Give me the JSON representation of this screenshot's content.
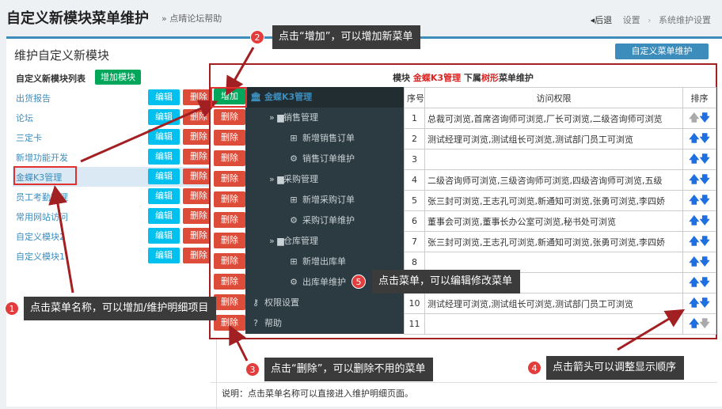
{
  "header": {
    "title": "自定义新模块菜单维护",
    "help": "» 点晴论坛帮助",
    "back": "后退",
    "crumbs": [
      "设置",
      "系统维护设置"
    ]
  },
  "panel": {
    "title": "维护自定义新模块",
    "top_button": "自定义菜单维护"
  },
  "module_list": {
    "heading": "自定义新模块列表",
    "add_button": "增加模块",
    "edit_label": "编辑",
    "delete_label": "删除",
    "items": [
      {
        "name": "出货报告"
      },
      {
        "name": "论坛"
      },
      {
        "name": "三定卡"
      },
      {
        "name": "新增功能开发"
      },
      {
        "name": "金蝶K3管理"
      },
      {
        "name": "员工考勤管理"
      },
      {
        "name": "常用网站访问"
      },
      {
        "name": "自定义模块2"
      },
      {
        "name": "自定义模块1"
      }
    ]
  },
  "frame": {
    "title_prefix": "模块 ",
    "title_module": "金蝶K3管理",
    "title_mid": " 下属",
    "title_tree": "树形",
    "title_suffix": "菜单维护",
    "add_label": "增加",
    "delete_label": "删除"
  },
  "tree": [
    {
      "label": "金蝶K3管理",
      "icon": "bank-icon",
      "glyph": "🏛",
      "indent": 0,
      "root": true
    },
    {
      "label": "销售管理",
      "icon": "folder-icon",
      "glyph": "» ▆",
      "indent": 1
    },
    {
      "label": "新增销售订单",
      "icon": "plus-square-icon",
      "glyph": "⊞",
      "indent": 2
    },
    {
      "label": "销售订单维护",
      "icon": "gear-icon",
      "glyph": "⚙",
      "indent": 2
    },
    {
      "label": "采购管理",
      "icon": "folder-icon",
      "glyph": "» ▆",
      "indent": 1
    },
    {
      "label": "新增采购订单",
      "icon": "plus-square-icon",
      "glyph": "⊞",
      "indent": 2
    },
    {
      "label": "采购订单维护",
      "icon": "gear-icon",
      "glyph": "⚙",
      "indent": 2
    },
    {
      "label": "仓库管理",
      "icon": "folder-icon",
      "glyph": "» ▆",
      "indent": 1
    },
    {
      "label": "新增出库单",
      "icon": "plus-square-icon",
      "glyph": "⊞",
      "indent": 2
    },
    {
      "label": "出库单维护",
      "icon": "gear-icon",
      "glyph": "⚙",
      "indent": 2
    },
    {
      "label": "权限设置",
      "icon": "key-icon",
      "glyph": "⚷",
      "indent": 0
    },
    {
      "label": "帮助",
      "icon": "help-icon",
      "glyph": "?",
      "indent": 0
    }
  ],
  "table": {
    "headers": [
      "序号",
      "访问权限",
      "排序"
    ],
    "rows": [
      {
        "no": "1",
        "perm": "总裁可浏览,首席咨询师可浏览,厂长可浏览,二级咨询师可浏览"
      },
      {
        "no": "2",
        "perm": "测试经理可浏览,测试组长可浏览,测试部门员工可浏览"
      },
      {
        "no": "3",
        "perm": ""
      },
      {
        "no": "4",
        "perm": "二级咨询师可浏览,三级咨询师可浏览,四级咨询师可浏览,五级"
      },
      {
        "no": "5",
        "perm": "张三封可浏览,王志孔可浏览,新通知可浏览,张勇可浏览,李四娇"
      },
      {
        "no": "6",
        "perm": "董事会可浏览,董事长办公室可浏览,秘书处可浏览"
      },
      {
        "no": "7",
        "perm": "张三封可浏览,王志孔可浏览,新通知可浏览,张勇可浏览,李四娇"
      },
      {
        "no": "8",
        "perm": ""
      },
      {
        "no": "9",
        "perm": ""
      },
      {
        "no": "10",
        "perm": "测试经理可浏览,测试组长可浏览,测试部门员工可浏览"
      },
      {
        "no": "11",
        "perm": ""
      }
    ]
  },
  "note": "说明：点击菜单名称可以直接进入维护明细页面。",
  "callouts": [
    {
      "num": "1",
      "text": "点击菜单名称，可以增加/维护明细项目"
    },
    {
      "num": "2",
      "text": "点击“增加”，可以增加新菜单"
    },
    {
      "num": "3",
      "text": "点击“删除”，可以删除不用的菜单"
    },
    {
      "num": "4",
      "text": "点击箭头可以调整显示顺序"
    },
    {
      "num": "5",
      "text": "点击菜单，可以编辑修改菜单"
    }
  ],
  "colors": {
    "accent": "#3c8dbc",
    "success": "#00a65a",
    "danger": "#dd4b39",
    "info": "#00c0ef",
    "frame": "#a21f22",
    "callout": "#3b3b3b"
  }
}
